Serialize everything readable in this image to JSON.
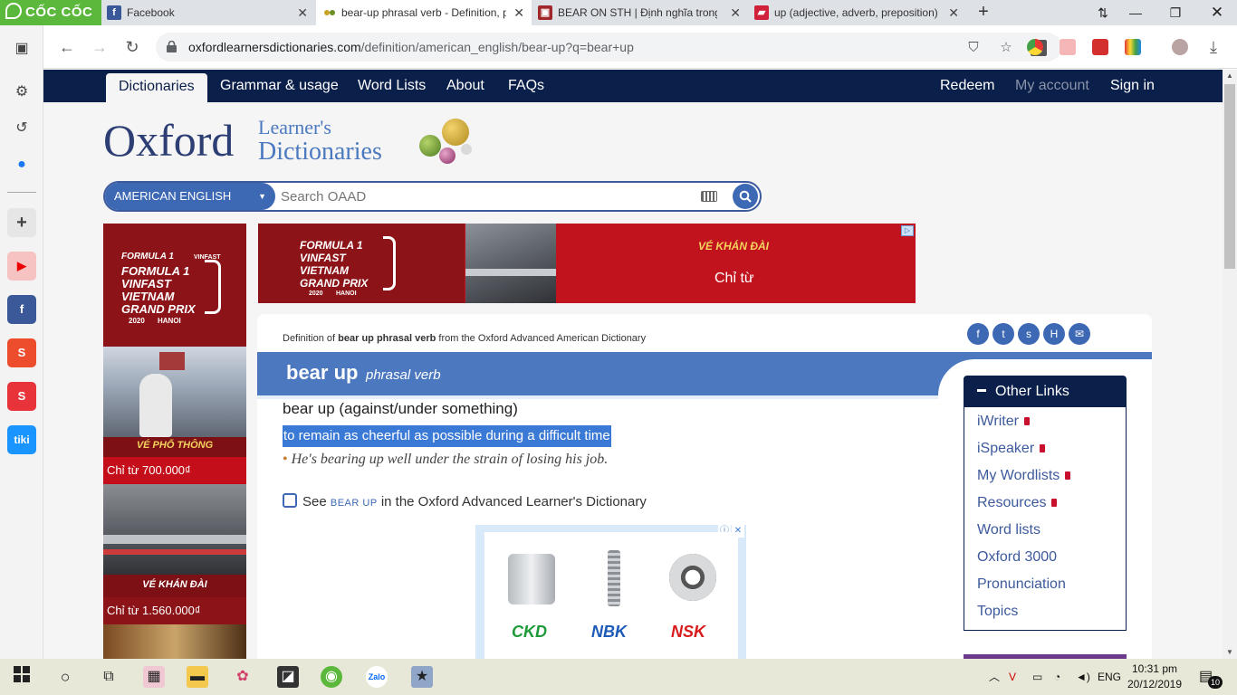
{
  "browser": {
    "brand": "CỐC CỐC",
    "tabs": [
      {
        "title": "Facebook",
        "favicon": "facebook-icon"
      },
      {
        "title": "bear-up phrasal verb - Definition, p",
        "favicon": "oxford-icon"
      },
      {
        "title": "BEAR ON STH | Định nghĩa trong T",
        "favicon": "cambridge-icon"
      },
      {
        "title": "up (adjective, adverb, preposition)",
        "favicon": "merriam-icon"
      }
    ],
    "url_host": "oxfordlearnersdictionaries.com",
    "url_path": "/definition/american_english/bear-up?q=bear+up"
  },
  "site": {
    "nav": [
      "Dictionaries",
      "Grammar & usage",
      "Word Lists",
      "About",
      "FAQs"
    ],
    "nav_right": [
      "Redeem",
      "My account",
      "Sign in"
    ],
    "logo_main": "Oxford",
    "logo_line1": "Learner's",
    "logo_line2": "Dictionaries",
    "dict_select": "AMERICAN ENGLISH",
    "search_placeholder": "Search OAAD"
  },
  "ads": {
    "left_brand_1": "FORMULA 1",
    "left_brand_2": "VINFAST",
    "left_brand_3": "VIETNAM",
    "left_brand_4": "GRAND PRIX",
    "left_brand_5": "2020",
    "left_brand_6": "HANOI",
    "left_label_1": "VÉ PHỔ THÔNG",
    "left_price_1": "Chỉ từ  700.000₫",
    "left_label_2": "VÉ KHÁN ĐÀI",
    "left_price_2": "Chỉ từ  1.560.000₫",
    "top_label": "VÉ KHÁN ĐÀI",
    "top_price": "Chỉ từ",
    "mid_brands": [
      "CKD",
      "NBK",
      "NSK"
    ]
  },
  "entry": {
    "source_prefix": "Definition of ",
    "source_bold": "bear up phrasal verb",
    "source_suffix": " from the Oxford Advanced American Dictionary",
    "headword": "bear up",
    "pos": "phrasal verb",
    "phrase": "bear up (against/under something)",
    "definition": "to remain as cheerful as possible during a difficult time",
    "example": "He's bearing up well under the strain of losing his job.",
    "see_prefix": "See ",
    "see_link": "BEAR UP",
    "see_suffix": " in the Oxford Advanced Learner's Dictionary"
  },
  "other_links": {
    "title": "Other Links",
    "items": [
      "iWriter",
      "iSpeaker",
      "My Wordlists",
      "Resources",
      "Word lists",
      "Oxford 3000",
      "Pronunciation",
      "Topics"
    ]
  },
  "taskbar": {
    "lang": "ENG",
    "time": "10:31 pm",
    "date": "20/12/2019",
    "notifications": "10"
  },
  "colors": {
    "navy": "#0b1f4b",
    "oxford_blue": "#4c78c0",
    "coccoc_green": "#5cb83c",
    "ad_red": "#c1131d"
  }
}
